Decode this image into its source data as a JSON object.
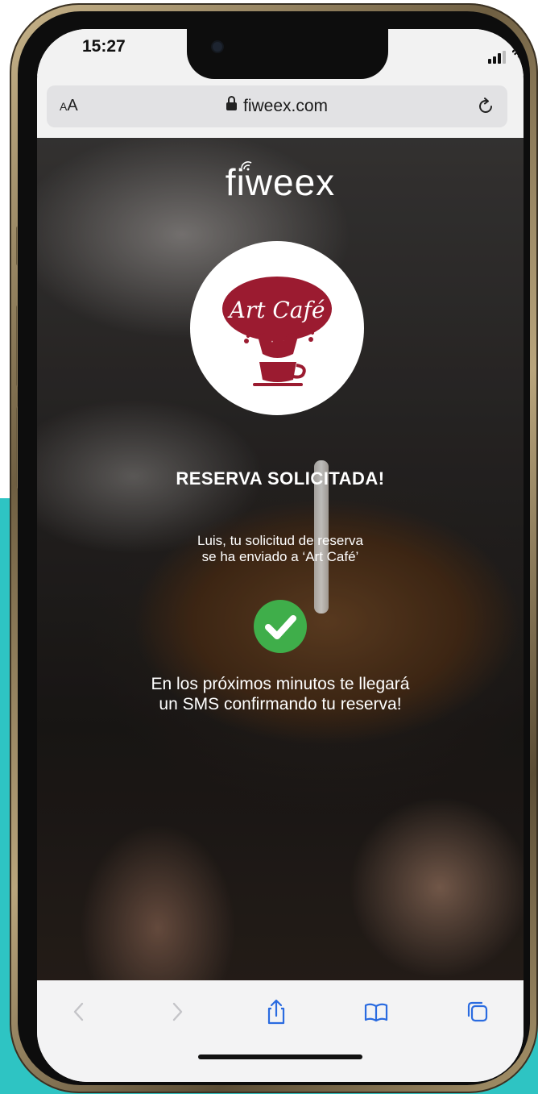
{
  "status_bar": {
    "time": "15:27"
  },
  "browser": {
    "text_size_label": "AA",
    "url": "fiweex.com"
  },
  "page": {
    "brand": "fiweex",
    "logo_text": "Art Café",
    "heading": "RESERVA SOLICITADA!",
    "message_line1": "Luis, tu solicitud de reserva",
    "message_line2": "se ha enviado a ‘Art Café’",
    "sms_line1": "En los próximos minutos te llegará",
    "sms_line2": "un SMS confirmando tu reserva!"
  },
  "toolbar": {
    "icons": [
      "back-icon",
      "forward-icon",
      "share-icon",
      "bookmarks-icon",
      "tabs-icon"
    ]
  },
  "colors": {
    "accent_teal": "#2ec4c3",
    "check_green": "#3fae4a",
    "logo_red": "#9b1b30"
  }
}
